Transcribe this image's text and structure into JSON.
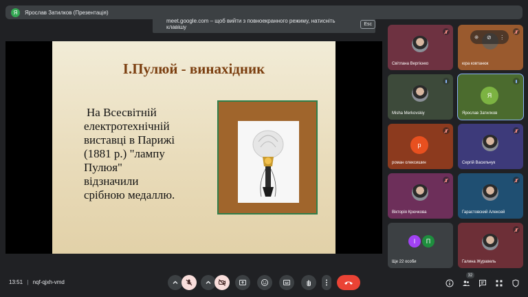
{
  "presenter": {
    "initial": "Я",
    "name": "Ярослав Затилков (Презентація)",
    "color": "#34a853"
  },
  "fullscreen_notice": {
    "text": "meet.google.com – щоб вийти з повноекранного режиму, натисніть клавішу",
    "key": "Esc"
  },
  "slide": {
    "title": "І.Пулюй - винахідник",
    "lines": [
      "На Всесвітній",
      "електротехнічній",
      "виставці в Парижі",
      "(1881 р.) \"лампу",
      "Пулюя\"",
      "відзначили",
      "срібною медаллю."
    ]
  },
  "participants": [
    {
      "name": "Світлана Вергієнко",
      "bg": "#6e3241",
      "mic": "off",
      "kind": "photo"
    },
    {
      "name": "юра ковтанюк",
      "bg": "#9a5a2e",
      "mic": "off",
      "kind": "controls"
    },
    {
      "name": "Misha Merkovskiy",
      "bg": "#3d4a3a",
      "mic": "on",
      "kind": "photo"
    },
    {
      "name": "Ярослав Затилков",
      "bg": "#4b6b2e",
      "mic": "on",
      "kind": "initial",
      "initial": "Я",
      "circle": "#7cb342"
    },
    {
      "name": "роман олексишин",
      "bg": "#8c3a1e",
      "mic": "off",
      "kind": "initial",
      "initial": "р",
      "circle": "#e8501f"
    },
    {
      "name": "Сергій Васильчук",
      "bg": "#3d3a7a",
      "mic": "off",
      "kind": "photo"
    },
    {
      "name": "Вікторія Крючкова",
      "bg": "#6d2f5a",
      "mic": "off",
      "kind": "photo"
    },
    {
      "name": "Гарастовский Алексей",
      "bg": "#1f4f72",
      "mic": "off",
      "kind": "photo"
    },
    {
      "name": "Ще 22 особи",
      "bg": "#3c4043",
      "mic": "none",
      "kind": "group",
      "initials": [
        "І",
        "П"
      ],
      "circles": [
        "#a142f4",
        "#1e8e3e"
      ]
    },
    {
      "name": "Галина Журавель",
      "bg": "#6d2f37",
      "mic": "off",
      "kind": "photo"
    }
  ],
  "tile_controls": [
    "⁜",
    "⊘",
    "⋮"
  ],
  "bottom": {
    "time": "13:51",
    "meeting_code": "nqf-qjxh-vmd",
    "people_count": "32"
  }
}
